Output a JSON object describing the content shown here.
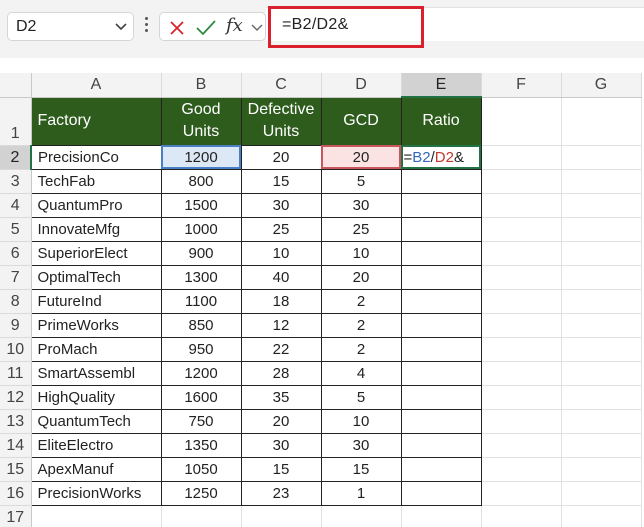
{
  "formula_bar": {
    "name_box": "D2",
    "fx_label": "fx",
    "formula": "=B2/D2&"
  },
  "icons": {
    "name_box_dropdown": "chevron-down-icon",
    "options": "vertical-dots-icon",
    "cancel": "x-icon",
    "enter": "check-icon",
    "fx_dropdown": "chevron-down-icon"
  },
  "colors": {
    "header_fill": "#2e5c1d",
    "b2_ref": "#3567b8",
    "d2_ref": "#c0392b",
    "formula_highlight": "#d9202c"
  },
  "grid": {
    "column_letters": [
      "A",
      "B",
      "C",
      "D",
      "E",
      "F",
      "G"
    ],
    "row_numbers": [
      "1",
      "2",
      "3",
      "4",
      "5",
      "6",
      "7",
      "8",
      "9",
      "10",
      "11",
      "12",
      "13",
      "14",
      "15",
      "16",
      "17"
    ],
    "headers": {
      "factory": "Factory",
      "good_units": "Good Units",
      "defective_units": "Defective Units",
      "gcd": "GCD",
      "ratio": "Ratio"
    },
    "editing_cell": {
      "ref_b": "B2",
      "slash": "/",
      "ref_d": "D2",
      "tail": "&",
      "leading": "="
    },
    "rows": [
      {
        "factory": "PrecisionCo",
        "good": "1200",
        "defective": "20",
        "gcd": "20"
      },
      {
        "factory": "TechFab",
        "good": "800",
        "defective": "15",
        "gcd": "5"
      },
      {
        "factory": "QuantumPro",
        "good": "1500",
        "defective": "30",
        "gcd": "30"
      },
      {
        "factory": "InnovateMfg",
        "good": "1000",
        "defective": "25",
        "gcd": "25"
      },
      {
        "factory": "SuperiorElect",
        "good": "900",
        "defective": "10",
        "gcd": "10"
      },
      {
        "factory": "OptimalTech",
        "good": "1300",
        "defective": "40",
        "gcd": "20"
      },
      {
        "factory": "FutureInd",
        "good": "1100",
        "defective": "18",
        "gcd": "2"
      },
      {
        "factory": "PrimeWorks",
        "good": "850",
        "defective": "12",
        "gcd": "2"
      },
      {
        "factory": "ProMach",
        "good": "950",
        "defective": "22",
        "gcd": "2"
      },
      {
        "factory": "SmartAssembl",
        "good": "1200",
        "defective": "28",
        "gcd": "4"
      },
      {
        "factory": "HighQuality",
        "good": "1600",
        "defective": "35",
        "gcd": "5"
      },
      {
        "factory": "QuantumTech",
        "good": "750",
        "defective": "20",
        "gcd": "10"
      },
      {
        "factory": "EliteElectro",
        "good": "1350",
        "defective": "30",
        "gcd": "30"
      },
      {
        "factory": "ApexManuf",
        "good": "1050",
        "defective": "15",
        "gcd": "15"
      },
      {
        "factory": "PrecisionWorks",
        "good": "1250",
        "defective": "23",
        "gcd": "1"
      }
    ]
  }
}
